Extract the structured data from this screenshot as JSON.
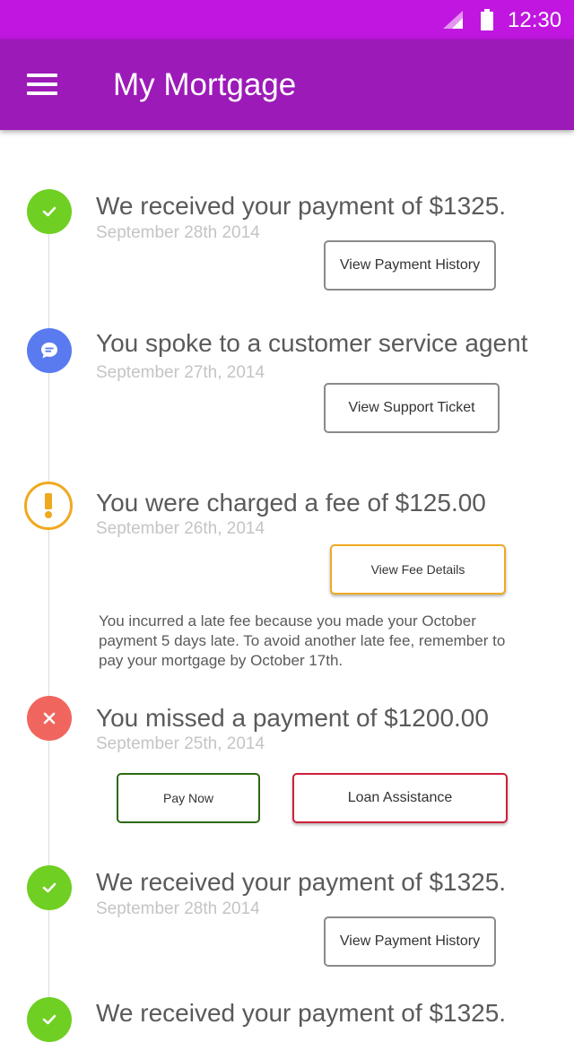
{
  "status_bar": {
    "time": "12:30"
  },
  "app_bar": {
    "title": "My Mortgage"
  },
  "events": [
    {
      "icon": "check-icon",
      "color": "#6fcf22",
      "headline": "We received your payment of $1325.",
      "date": "September 28th 2014",
      "button": "View Payment History"
    },
    {
      "icon": "chat-icon",
      "color": "#5a7bef",
      "headline": "You spoke to a customer service agent",
      "date": "September 27th, 2014",
      "button": "View Support Ticket"
    },
    {
      "icon": "warning-icon",
      "color": "#f0a91f",
      "headline": "You were charged a fee of $125.00",
      "date": "September 26th, 2014",
      "button": "View Fee Details",
      "note": "You incurred a late fee because you made your October payment 5 days late. To avoid another late fee, remember to pay your mortgage by October 17th."
    },
    {
      "icon": "error-icon",
      "color": "#f0665f",
      "headline": "You missed a payment of $1200.00",
      "date": "September 25th, 2014",
      "button_primary": "Pay Now",
      "button_secondary": "Loan Assistance"
    },
    {
      "icon": "check-icon",
      "color": "#6fcf22",
      "headline": "We received your payment of $1325.",
      "date": "September 28th 2014",
      "button": "View Payment History"
    },
    {
      "icon": "check-icon",
      "color": "#6fcf22",
      "headline": "We received your payment of $1325."
    }
  ]
}
